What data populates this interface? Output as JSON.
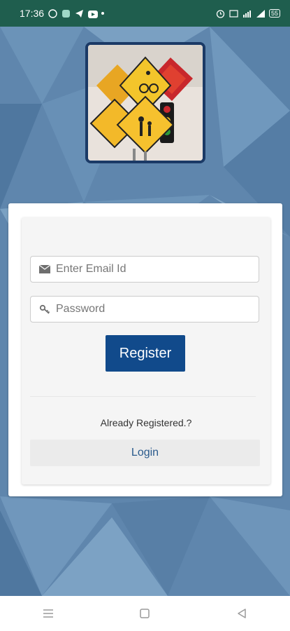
{
  "status_bar": {
    "time": "17:36",
    "battery": "55"
  },
  "app": {
    "logo_icon": "road-signs-logo"
  },
  "form": {
    "email": {
      "placeholder": "Enter Email Id",
      "value": "",
      "icon": "envelope-icon"
    },
    "password": {
      "placeholder": "Password",
      "value": "",
      "icon": "key-icon"
    },
    "register_label": "Register",
    "already_registered_text": "Already Registered.?",
    "login_label": "Login"
  },
  "nav_bar": {
    "items": [
      "menu-icon",
      "home-icon",
      "back-icon"
    ]
  },
  "colors": {
    "status_bar": "#1f5e4e",
    "background": "#5f86ad",
    "primary_button": "#114a8b",
    "login_text": "#2a5a8c"
  }
}
